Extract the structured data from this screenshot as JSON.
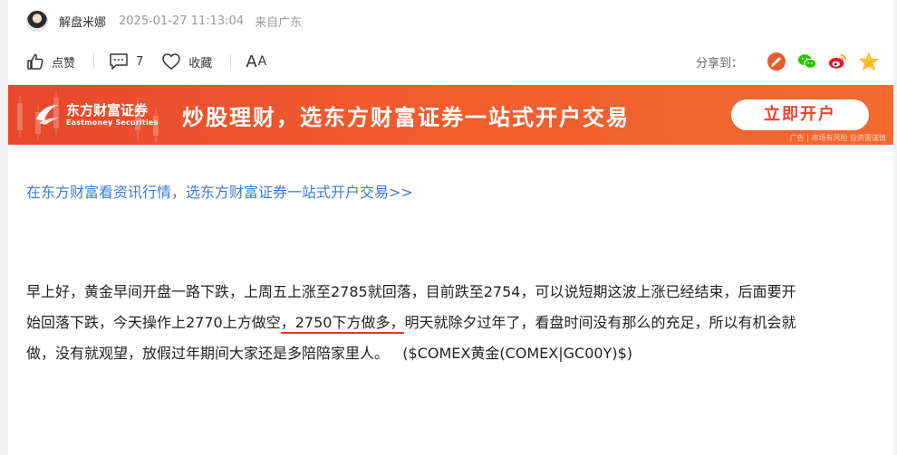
{
  "author": {
    "name": "解盘米娜",
    "time": "2025-01-27 11:13:04",
    "location": "来自广东"
  },
  "actions": {
    "like_label": "点赞",
    "comment_count": "7",
    "favorite_label": "收藏",
    "font_label_big": "A",
    "font_label_small": "A"
  },
  "share": {
    "label": "分享到：",
    "targets": [
      "toutiao",
      "wechat",
      "weibo",
      "qzone"
    ]
  },
  "banner": {
    "brand_cn": "东方财富证券",
    "brand_en": "Eastmoney Securities",
    "slogan": "炒股理财，选东方财富证券一站式开户交易",
    "button": "立即开户",
    "ad_note": "广告 | 市场有风险 投资需谨慎"
  },
  "promo_link": "在东方财富看资讯行情，选东方财富证券一站式开户交易>>",
  "article": {
    "line1": "早上好，黄金早间开盘一路下跌，上周五上涨至2785就回落，目前跌至2754，可以说短期这波上涨已经结束，后面要开",
    "line2a": "始回落下跌，今天操作上2770上方做空",
    "line2_highlight": "，2750下方做多，",
    "line2b": "明天就除夕过年了，看盘时间没有那么的充足，所以有机会就",
    "line3": "做，没有就观望，放假过年期间大家还是多陪陪家里人。",
    "stock_ref": "($COMEX黄金(COMEX|GC00Y)$)"
  },
  "colors": {
    "banner_start": "#e8472c",
    "banner_end": "#f26a30",
    "link": "#3d7ad6",
    "highlight_underline": "#ee3333"
  }
}
